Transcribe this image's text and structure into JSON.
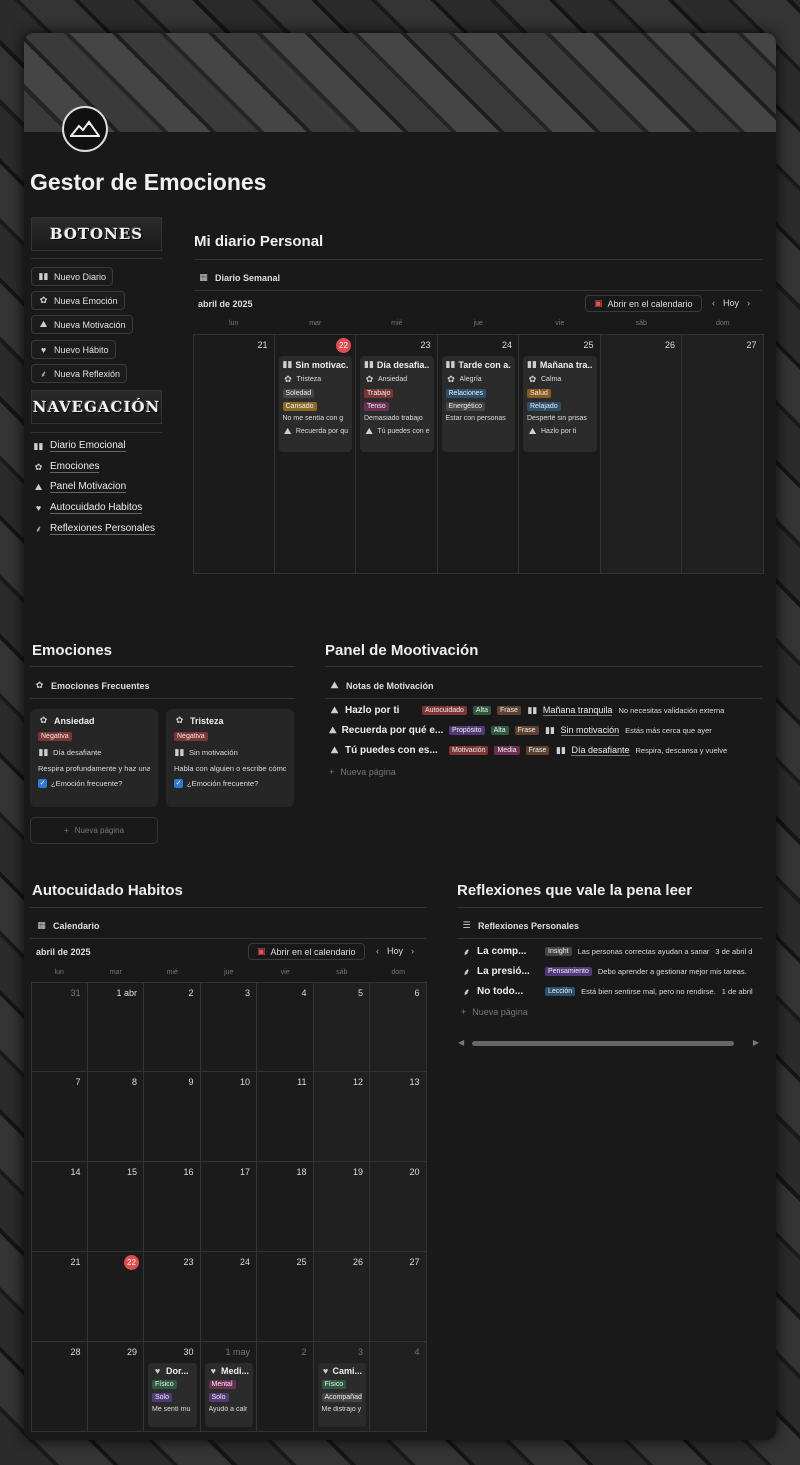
{
  "page_title": "Gestor de Emociones",
  "banners": {
    "botones": "BOTONES",
    "navegacion": "NAVEGACIÓN"
  },
  "buttons": [
    {
      "icon": "book-icon",
      "label": "Nuevo Diario"
    },
    {
      "icon": "chat-icon",
      "label": "Nueva Emoción"
    },
    {
      "icon": "climber-icon",
      "label": "Nueva Motivación"
    },
    {
      "icon": "heart-icon",
      "label": "Nuevo Hábito"
    },
    {
      "icon": "leaf-icon",
      "label": "Nueva Reflexión"
    }
  ],
  "nav_links": [
    {
      "icon": "book-icon",
      "label": "Diario Emocional"
    },
    {
      "icon": "chat-icon",
      "label": "Emociones"
    },
    {
      "icon": "climber-icon",
      "label": "Panel Motivacion"
    },
    {
      "icon": "heart-icon",
      "label": "Autocuidado Habitos"
    },
    {
      "icon": "leaf-icon",
      "label": "Reflexiones Personales"
    }
  ],
  "diario": {
    "heading": "Mi diario Personal",
    "view_label": "Diario Semanal",
    "month": "abril de 2025",
    "open_calendar": "Abrir en el calendario",
    "today_btn": "Hoy",
    "weekdays": [
      "lun",
      "mar",
      "mié",
      "jue",
      "vie",
      "sáb",
      "dom"
    ],
    "days": [
      "21",
      "22",
      "23",
      "24",
      "25",
      "26",
      "27"
    ],
    "today_index": 1,
    "entries": [
      {
        "day_index": 1,
        "title": "Sin motivac...",
        "emotion": "Tristeza",
        "tags": [
          {
            "t": "Soledad",
            "c": "tg-gray"
          },
          {
            "t": "Cansado",
            "c": "tg-yellow"
          }
        ],
        "text": "No me sentía con g",
        "link": "Recuerda por qu"
      },
      {
        "day_index": 2,
        "title": "Día desafia...",
        "emotion": "Ansiedad",
        "tags": [
          {
            "t": "Trabajo",
            "c": "tg-red"
          },
          {
            "t": "Tenso",
            "c": "tg-pink"
          }
        ],
        "text": "Demasiado trabajo",
        "link": "Tú puedes con e"
      },
      {
        "day_index": 3,
        "title": "Tarde con a...",
        "emotion": "Alegría",
        "tags": [
          {
            "t": "Relaciones",
            "c": "tg-blue"
          },
          {
            "t": "Energético",
            "c": "tg-gray"
          }
        ],
        "text": "Estar con personas",
        "link": ""
      },
      {
        "day_index": 4,
        "title": "Mañana tra...",
        "emotion": "Calma",
        "tags": [
          {
            "t": "Salud",
            "c": "tg-orange"
          },
          {
            "t": "Relajado",
            "c": "tg-blue"
          }
        ],
        "text": "Desperté sin prisas",
        "link": "Hazlo por ti"
      }
    ]
  },
  "emociones": {
    "heading": "Emociones",
    "view_label": "Emociones Frecuentes",
    "cards": [
      {
        "name": "Ansiedad",
        "tag": "Negativa",
        "diario": "Día desafiante",
        "text": "Respira profundamente y haz una p",
        "check": "¿Emoción frecuente?"
      },
      {
        "name": "Tristeza",
        "tag": "Negativa",
        "diario": "Sin motivación",
        "text": "Habla con alguien o escribe cómo t",
        "check": "¿Emoción frecuente?"
      }
    ],
    "new_page": "Nueva página"
  },
  "motivacion": {
    "heading": "Panel de Mootivación",
    "view_label": "Notas de Motivación",
    "rows": [
      {
        "title": "Hazlo por ti",
        "t1": {
          "t": "Autocuidado",
          "c": "tg-red"
        },
        "t2": {
          "t": "Alta",
          "c": "tg-green"
        },
        "t3": {
          "t": "Frase",
          "c": "tg-brown"
        },
        "rel": "Mañana tranquila",
        "text": "No necesitas validación externa"
      },
      {
        "title": "Recuerda por qué e...",
        "t1": {
          "t": "Propósito",
          "c": "tg-purple"
        },
        "t2": {
          "t": "Alta",
          "c": "tg-green"
        },
        "t3": {
          "t": "Frase",
          "c": "tg-brown"
        },
        "rel": "Sin motivación",
        "text": "Estás más cerca que ayer"
      },
      {
        "title": "Tú puedes con es...",
        "t1": {
          "t": "Motivación",
          "c": "tg-red"
        },
        "t2": {
          "t": "Media",
          "c": "tg-pink"
        },
        "t3": {
          "t": "Frase",
          "c": "tg-brown"
        },
        "rel": "Día desafiante",
        "text": "Respira, descansa y vuelve"
      }
    ],
    "new_page": "Nueva página"
  },
  "habitos": {
    "heading": "Autocuidado Habitos",
    "view_label": "Calendario",
    "month": "abril de 2025",
    "open_calendar": "Abrir en el calendario",
    "today_btn": "Hoy",
    "weekdays": [
      "lun",
      "mar",
      "mié",
      "jue",
      "vie",
      "sáb",
      "dom"
    ],
    "weeks": [
      [
        "31",
        "1 abr",
        "2",
        "3",
        "4",
        "5",
        "6"
      ],
      [
        "7",
        "8",
        "9",
        "10",
        "11",
        "12",
        "13"
      ],
      [
        "14",
        "15",
        "16",
        "17",
        "18",
        "19",
        "20"
      ],
      [
        "21",
        "22",
        "23",
        "24",
        "25",
        "26",
        "27"
      ],
      [
        "28",
        "29",
        "30",
        "1 may",
        "2",
        "3",
        "4"
      ]
    ],
    "dim_cells": [
      "0-0",
      "4-3",
      "4-4",
      "4-5",
      "4-6"
    ],
    "today_cell": "3-1",
    "entries": [
      {
        "cell": "4-2",
        "title": "Dor...",
        "tags": [
          {
            "t": "Físico",
            "c": "tg-green"
          },
          {
            "t": "Solo",
            "c": "tg-purple"
          }
        ],
        "text": "Me sentí mu"
      },
      {
        "cell": "4-3",
        "title": "Medi...",
        "tags": [
          {
            "t": "Mental",
            "c": "tg-pink"
          },
          {
            "t": "Solo",
            "c": "tg-purple"
          }
        ],
        "text": "Ayudó a calr"
      },
      {
        "cell": "4-5",
        "title": "Cami...",
        "tags": [
          {
            "t": "Físico",
            "c": "tg-green"
          },
          {
            "t": "Acompañad",
            "c": "tg-gray"
          }
        ],
        "text": "Me distrajo y"
      }
    ]
  },
  "reflexiones": {
    "heading": "Reflexiones que vale la pena leer",
    "view_label": "Reflexiones Personales",
    "rows": [
      {
        "title": "La comp...",
        "tag": {
          "t": "Insight",
          "c": "tg-gray"
        },
        "text": "Las personas correctas ayudan a sanar",
        "date": "3 de abril d"
      },
      {
        "title": "La presió...",
        "tag": {
          "t": "Pensamiento",
          "c": "tg-purple"
        },
        "text": "Debo aprender a gestionar mejor mis tareas.",
        "date": ""
      },
      {
        "title": "No todo...",
        "tag": {
          "t": "Lección",
          "c": "tg-blue"
        },
        "text": "Está bien sentirse mal, pero no rendirse.",
        "date": "1 de abril"
      }
    ],
    "new_page": "Nueva página"
  }
}
